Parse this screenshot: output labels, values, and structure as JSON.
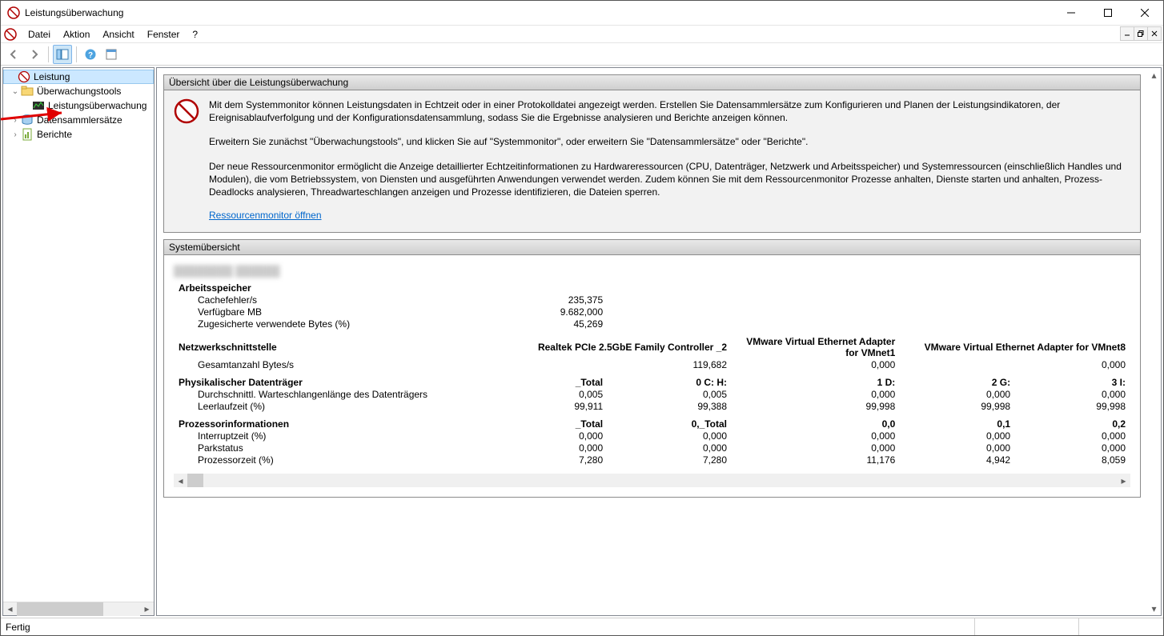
{
  "window": {
    "title": "Leistungsüberwachung"
  },
  "menu": {
    "datei": "Datei",
    "aktion": "Aktion",
    "ansicht": "Ansicht",
    "fenster": "Fenster",
    "help": "?"
  },
  "tree": {
    "root": "Leistung",
    "monitoring_tools": "Überwachungstools",
    "performance_monitor": "Leistungsüberwachung",
    "data_collector_sets": "Datensammlersätze",
    "reports": "Berichte"
  },
  "overview": {
    "header": "Übersicht über die Leistungsüberwachung",
    "p1": "Mit dem Systemmonitor können Leistungsdaten in Echtzeit oder in einer Protokolldatei angezeigt werden. Erstellen Sie Datensammlersätze zum Konfigurieren und Planen der Leistungsindikatoren, der Ereignisablaufverfolgung und der Konfigurationsdatensammlung, sodass Sie die Ergebnisse analysieren und Berichte anzeigen können.",
    "p2": "Erweitern Sie zunächst \"Überwachungstools\", und klicken Sie auf \"Systemmonitor\", oder erweitern Sie \"Datensammlersätze\" oder \"Berichte\".",
    "p3": "Der neue Ressourcenmonitor ermöglicht die Anzeige detaillierter Echtzeitinformationen zu Hardwareressourcen (CPU, Datenträger, Netzwerk und Arbeitsspeicher) und Systemressourcen (einschließlich Handles und Modulen), die vom Betriebssystem, von Diensten und ausgeführten Anwendungen verwendet werden. Zudem können Sie mit dem Ressourcenmonitor Prozesse anhalten, Dienste starten und anhalten, Prozess-Deadlocks analysieren, Threadwarteschlangen anzeigen und Prozesse identifizieren, die Dateien sperren.",
    "link": "Ressourcenmonitor öffnen"
  },
  "system": {
    "header": "Systemübersicht",
    "blurred_host": "████████ ██████",
    "memory": {
      "title": "Arbeitsspeicher",
      "rows": [
        {
          "label": "Cachefehler/s",
          "v1": "235,375"
        },
        {
          "label": "Verfügbare MB",
          "v1": "9.682,000"
        },
        {
          "label": "Zugesicherte verwendete Bytes (%)",
          "v1": "45,269"
        }
      ]
    },
    "network": {
      "title": "Netzwerkschnittstelle",
      "cols": [
        "Realtek PCIe 2.5GbE Family Controller _2",
        "VMware Virtual Ethernet Adapter for VMnet1",
        "VMware Virtual Ethernet Adapter for VMnet8"
      ],
      "rows": [
        {
          "label": "Gesamtanzahl Bytes/s",
          "v": [
            "119,682",
            "0,000",
            "0,000"
          ]
        }
      ]
    },
    "disk": {
      "title": "Physikalischer Datenträger",
      "cols": [
        "_Total",
        "0 C: H:",
        "1 D:",
        "2 G:",
        "3 I:"
      ],
      "rows": [
        {
          "label": "Durchschnittl. Warteschlangenlänge des Datenträgers",
          "v": [
            "0,005",
            "0,005",
            "0,000",
            "0,000",
            "0,000"
          ]
        },
        {
          "label": "Leerlaufzeit (%)",
          "v": [
            "99,911",
            "99,388",
            "99,998",
            "99,998",
            "99,998"
          ]
        }
      ]
    },
    "cpu": {
      "title": "Prozessorinformationen",
      "cols": [
        "_Total",
        "0,_Total",
        "0,0",
        "0,1",
        "0,2"
      ],
      "rows": [
        {
          "label": "Interruptzeit (%)",
          "v": [
            "0,000",
            "0,000",
            "0,000",
            "0,000",
            "0,000"
          ]
        },
        {
          "label": "Parkstatus",
          "v": [
            "0,000",
            "0,000",
            "0,000",
            "0,000",
            "0,000"
          ]
        },
        {
          "label": "Prozessorzeit (%)",
          "v": [
            "7,280",
            "7,280",
            "11,176",
            "4,942",
            "8,059"
          ]
        }
      ]
    }
  },
  "status": {
    "text": "Fertig"
  }
}
